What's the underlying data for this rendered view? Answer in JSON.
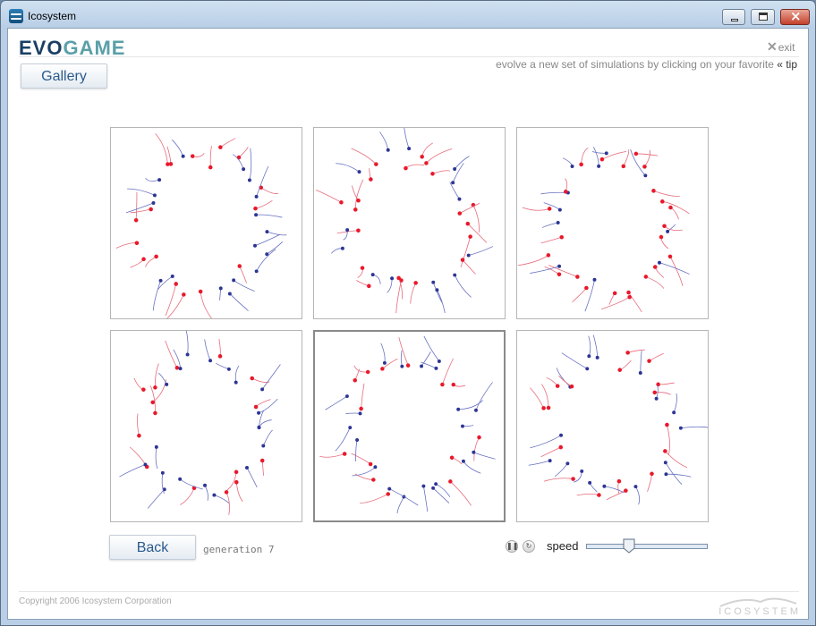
{
  "window": {
    "title": "Icosystem",
    "app_icon": "icosystem-logo-icon",
    "controls": [
      "minimize-icon",
      "maximize-icon",
      "close-icon"
    ]
  },
  "header": {
    "logo_evo": "EVO",
    "logo_game": "GAME",
    "exit_label": "exit",
    "tagline": "evolve a new set of simulations by clicking on your favorite",
    "tip_marker": "«",
    "tip_label": "tip",
    "gallery_label": "Gallery"
  },
  "grid": {
    "columns": 3,
    "rows": 2,
    "selected_index": 4,
    "tile_count": 6
  },
  "controls": {
    "back_label": "Back",
    "generation_text": "generation 7",
    "pause_icon": "pause-icon",
    "restart_icon": "restart-icon",
    "speed_label": "speed",
    "speed_value": 0.35
  },
  "footer": {
    "copyright": "Copyright 2006 Icosystem Corporation",
    "logo_text": "ICOSYSTEM"
  },
  "colors": {
    "logo_evo": "#1a3f63",
    "logo_game": "#5aa0a8",
    "agent_red": "#e8192b",
    "agent_blue": "#2c3594",
    "trail_red": "#e66a7a",
    "trail_blue": "#6670c0",
    "button_text": "#2b5b8c"
  }
}
